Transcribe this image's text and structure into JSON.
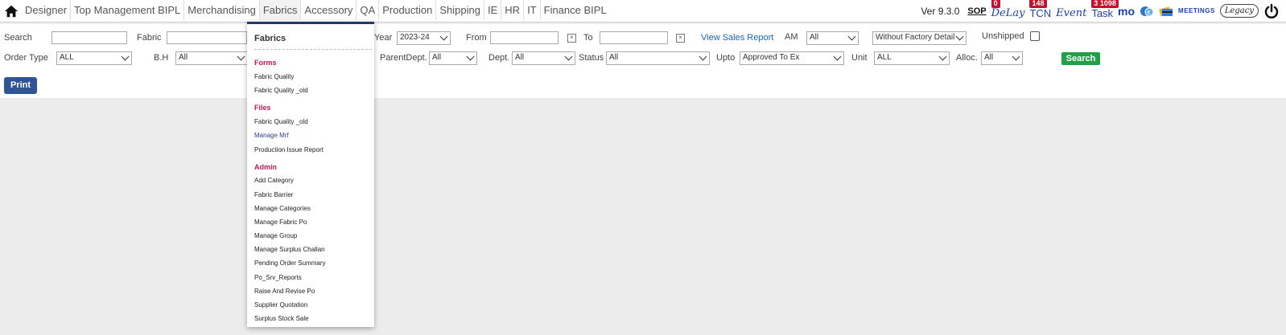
{
  "nav": {
    "items": [
      "Designer",
      "Top Management BIPL",
      "Merchandising",
      "Fabrics",
      "Accessory",
      "QA",
      "Production",
      "Shipping",
      "IE",
      "HR",
      "IT",
      "Finance BIPL"
    ],
    "active": "Fabrics",
    "version": "Ver 9.3.0",
    "sop": "SOP",
    "tools": {
      "delay": {
        "label": "DeLay",
        "badge": "0"
      },
      "tcn": {
        "label": "TCN",
        "badge": "148"
      },
      "event": {
        "label": "Event"
      },
      "task": {
        "label": "Task",
        "badge": "3 1098"
      },
      "mo": "mo",
      "meetings": "MEETINGS",
      "legacy": "Legacy"
    }
  },
  "filters": {
    "search_label": "Search",
    "fabric_label": "Fabric",
    "year_label": "Year",
    "year_value": "2023-24",
    "from_label": "From",
    "to_label": "To",
    "view_sales_report": "View Sales Report",
    "am_label": "AM",
    "am_value": "All",
    "factory_detail_value": "Without Factory Detail",
    "unshipped_label": "Unshipped",
    "order_type_label": "Order Type",
    "order_type_value": "ALL",
    "bh_label": "B.H",
    "bh_value": "All",
    "parent_dept_label": "ParentDept.",
    "parent_dept_value": "All",
    "dept_label": "Dept.",
    "dept_value": "All",
    "status_label": "Status",
    "status_value": "All",
    "upto_label": "Upto",
    "upto_value": "Approved To Ex",
    "unit_label": "Unit",
    "unit_value": "ALL",
    "alloc_label": "Alloc.",
    "alloc_value": "All",
    "search_button": "Search",
    "print_button": "Print"
  },
  "dropdown": {
    "title": "Fabrics",
    "sections": [
      {
        "heading": "Forms",
        "items": [
          "Fabric Quality",
          "Fabric Quality _old"
        ]
      },
      {
        "heading": "Files",
        "items": [
          "Fabric Quality _old",
          "Manage Mrf",
          "Production Issue Report"
        ]
      },
      {
        "heading": "Admin",
        "items": [
          "Add Category",
          "Fabric Barrier",
          "Manage Categories",
          "Manage Fabric Po",
          "Manage Group",
          "Manage Surplus Challan",
          "Pending Order Summary",
          "Po_Srv_Reports",
          "Raise And Revise Po",
          "Supplier Quotation",
          "Surplus Stock Sale"
        ]
      }
    ]
  },
  "colors": {
    "accent_link": "#1565c0",
    "search_button": "#22a047",
    "print_button": "#2f5597",
    "section_heading": "#c2185b",
    "badge": "#c8102e"
  }
}
